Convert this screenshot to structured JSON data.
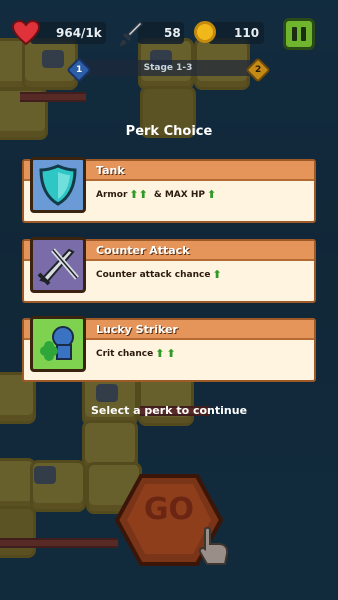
{
  "hud": {
    "health": "964/1k",
    "attack": "58",
    "coins": "110"
  },
  "stage": {
    "label": "Stage 1-3",
    "current_node": "1",
    "next_node": "2"
  },
  "perk_modal": {
    "title": "Perk Choice",
    "hint": "Select a perk to continue",
    "perks": [
      {
        "name": "Tank",
        "desc_a": "Armor",
        "desc_b": "& MAX HP",
        "icon": "shield-icon"
      },
      {
        "name": "Counter Attack",
        "desc_a": "Counter attack chance",
        "icon": "crossed-swords-icon"
      },
      {
        "name": "Lucky Striker",
        "desc_a": "Crit chance",
        "icon": "clover-knight-icon"
      }
    ]
  },
  "go_button": {
    "label": "GO"
  },
  "colors": {
    "card_header": "#e5955a",
    "card_body": "#fff4e0",
    "upgrade_arrow": "#2f9a24",
    "pause_green": "#6fb52e",
    "go_orange": "#d9622b"
  }
}
